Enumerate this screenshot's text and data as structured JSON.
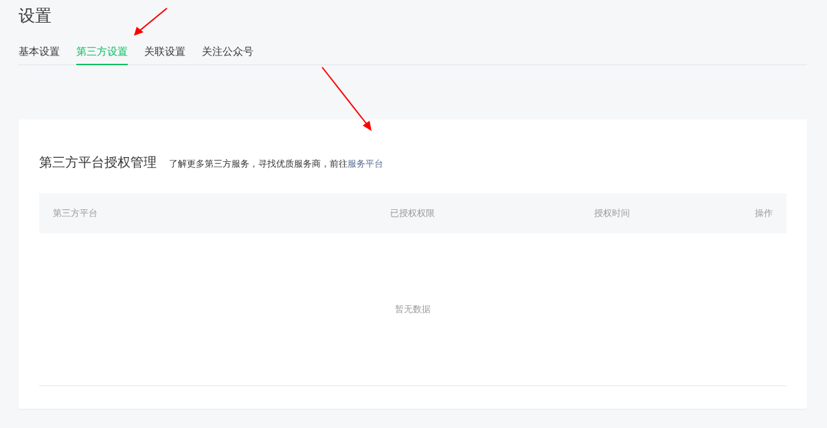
{
  "page": {
    "title": "设置"
  },
  "tabs": [
    {
      "label": "基本设置",
      "selected": false
    },
    {
      "label": "第三方设置",
      "selected": true
    },
    {
      "label": "关联设置",
      "selected": false
    },
    {
      "label": "关注公众号",
      "selected": false
    }
  ],
  "card": {
    "title": "第三方平台授权管理",
    "description": "了解更多第三方服务，寻找优质服务商，前往",
    "link": "服务平台"
  },
  "table": {
    "columns": [
      "第三方平台",
      "已授权权限",
      "授权时间",
      "操作"
    ],
    "empty_text": "暂无数据"
  }
}
